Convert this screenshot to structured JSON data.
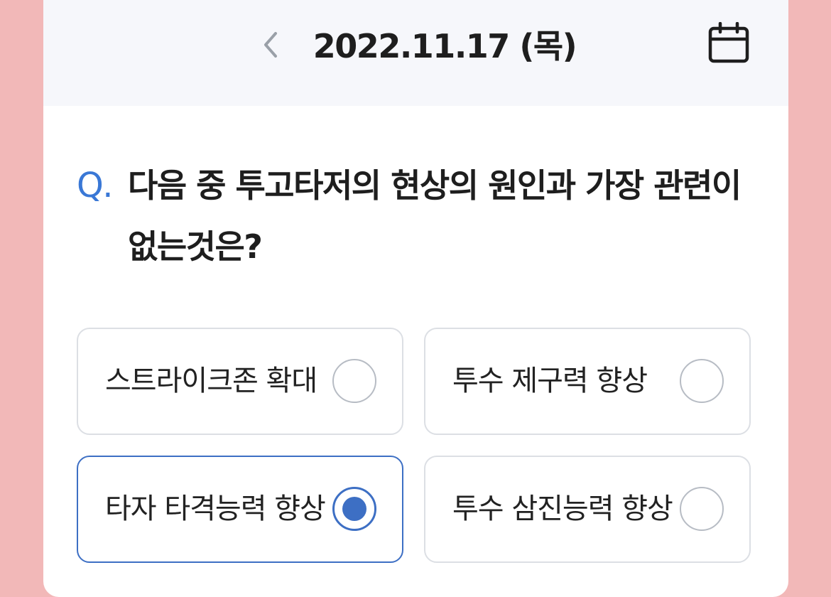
{
  "header": {
    "date": "2022.11.17 (목)",
    "prev_icon": "chevron-left-icon",
    "calendar_icon": "calendar-icon"
  },
  "question": {
    "prefix": "Q.",
    "text": "다음 중 투고타저의 현상의 원인과 가장 관련이 없는것은?"
  },
  "options": [
    {
      "label": "스트라이크존 확대",
      "selected": false
    },
    {
      "label": "투수 제구력 향상",
      "selected": false
    },
    {
      "label": "타자 타격능력 향상",
      "selected": true
    },
    {
      "label": "투수 삼진능력 향상",
      "selected": false
    }
  ],
  "colors": {
    "background": "#f2b8b8",
    "header_bg": "#f6f7fb",
    "accent": "#3d6fc4",
    "q_prefix": "#3a78d6",
    "option_border": "#dcdfe4"
  }
}
